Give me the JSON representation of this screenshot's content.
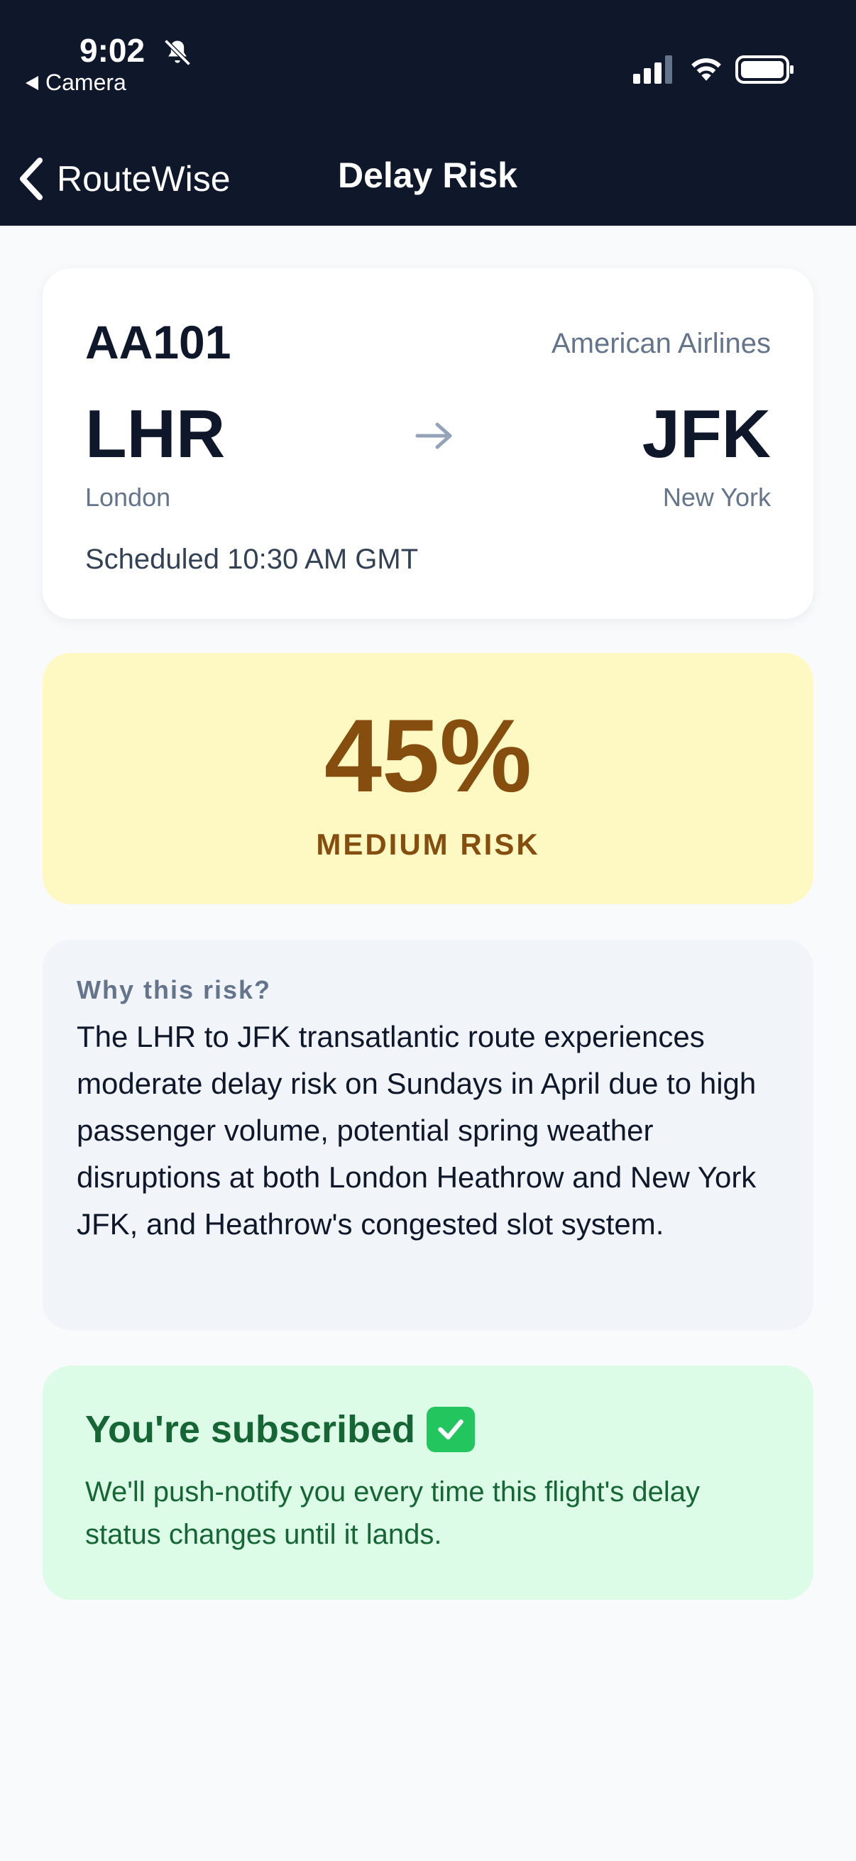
{
  "status_bar": {
    "time": "9:02",
    "back_app": "Camera",
    "icons": [
      "bell-slash-icon",
      "cellular-signal-icon",
      "wifi-icon",
      "battery-icon"
    ]
  },
  "nav": {
    "back_label": "RouteWise",
    "title": "Delay Risk"
  },
  "flight": {
    "number": "AA101",
    "airline": "American Airlines",
    "origin_code": "LHR",
    "origin_city": "London",
    "destination_code": "JFK",
    "destination_city": "New York",
    "scheduled": "Scheduled 10:30 AM GMT"
  },
  "risk": {
    "percent": "45%",
    "level": "MEDIUM RISK",
    "color_bg": "#fef9c3",
    "color_text": "#854d0e"
  },
  "why": {
    "title": "Why this risk?",
    "body": "The LHR to JFK transatlantic route experiences moderate delay risk on Sundays in April due to high passenger volume, potential spring weather disruptions at both London Heathrow and New York JFK, and Heathrow's congested slot system."
  },
  "subscription": {
    "title": "You're subscribed",
    "icon": "check-mark-icon",
    "body": "We'll push-notify you every time this flight's delay status changes until it lands.",
    "color_bg": "#dcfce7",
    "color_text": "#166534"
  },
  "colors": {
    "header_bg": "#0f172a",
    "page_bg": "#f8fafc"
  }
}
